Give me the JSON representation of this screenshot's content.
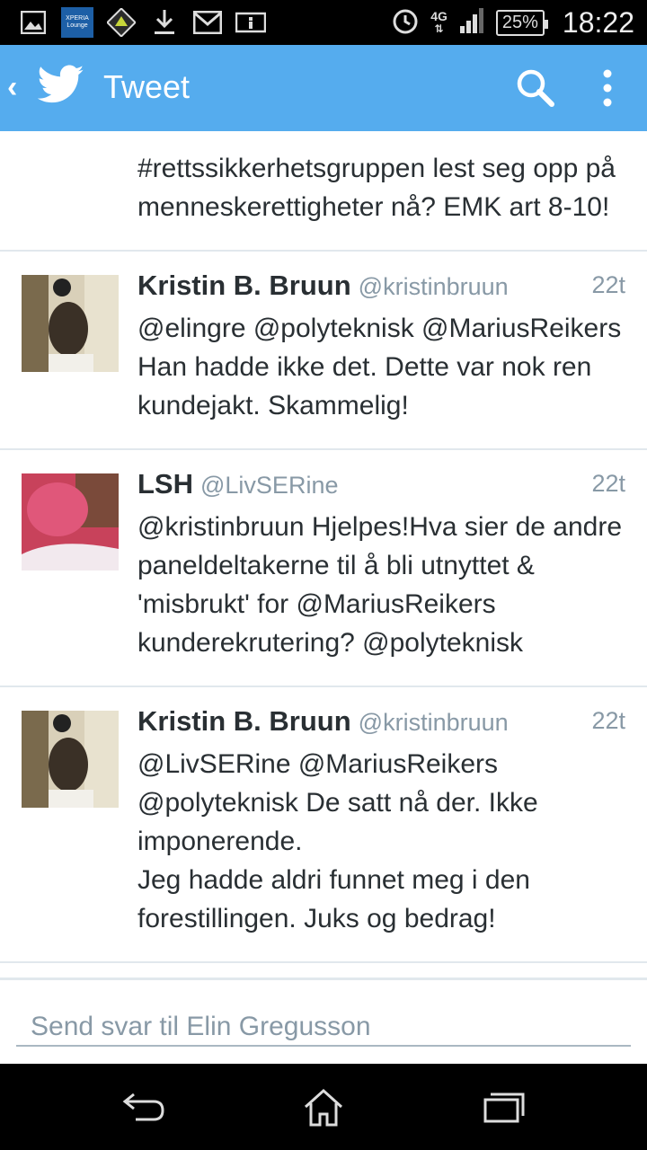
{
  "status_bar": {
    "notification_icons": [
      "image-icon",
      "xperia-lounge-icon",
      "app-icon",
      "download-icon",
      "gmail-icon",
      "info-icon"
    ],
    "xperia_label": "XPERIA Lounge",
    "network": "4G",
    "battery": "25%",
    "time": "18:22"
  },
  "action_bar": {
    "title": "Tweet",
    "back_icon": "chevron-left-icon",
    "logo_icon": "twitter-bird-icon",
    "search_icon": "search-icon",
    "menu_icon": "overflow-menu-icon",
    "color": "#55acee"
  },
  "partial_tweet": {
    "text": "#rettssikkerhetsgruppen lest seg opp på menneskerettigheter nå? EMK art 8-10!"
  },
  "tweets": [
    {
      "name": "Kristin B. Bruun",
      "handle": "@kristinbruun",
      "time": "22t",
      "text": "@elingre @polyteknisk @MariusReikers Han hadde ikke det. Dette var nok ren kundejakt. Skammelig!"
    },
    {
      "name": "LSH",
      "handle": "@LivSERine",
      "time": "22t",
      "text": "@kristinbruun Hjelpes!Hva sier de andre paneldeltakerne til å bli utnyttet & 'misbrukt' for @MariusReikers kunderekrutering? @polyteknisk"
    },
    {
      "name": "Kristin B. Bruun",
      "handle": "@kristinbruun",
      "time": "22t",
      "text": "@LivSERine @MariusReikers @polyteknisk De satt nå der.  Ikke imponerende.\nJeg hadde aldri funnet meg i den forestillingen. Juks og bedrag!"
    }
  ],
  "reply": {
    "placeholder": "Send svar til Elin Gregusson"
  },
  "nav_bar": {
    "back_icon": "back-icon",
    "home_icon": "home-icon",
    "recents_icon": "recent-apps-icon"
  }
}
